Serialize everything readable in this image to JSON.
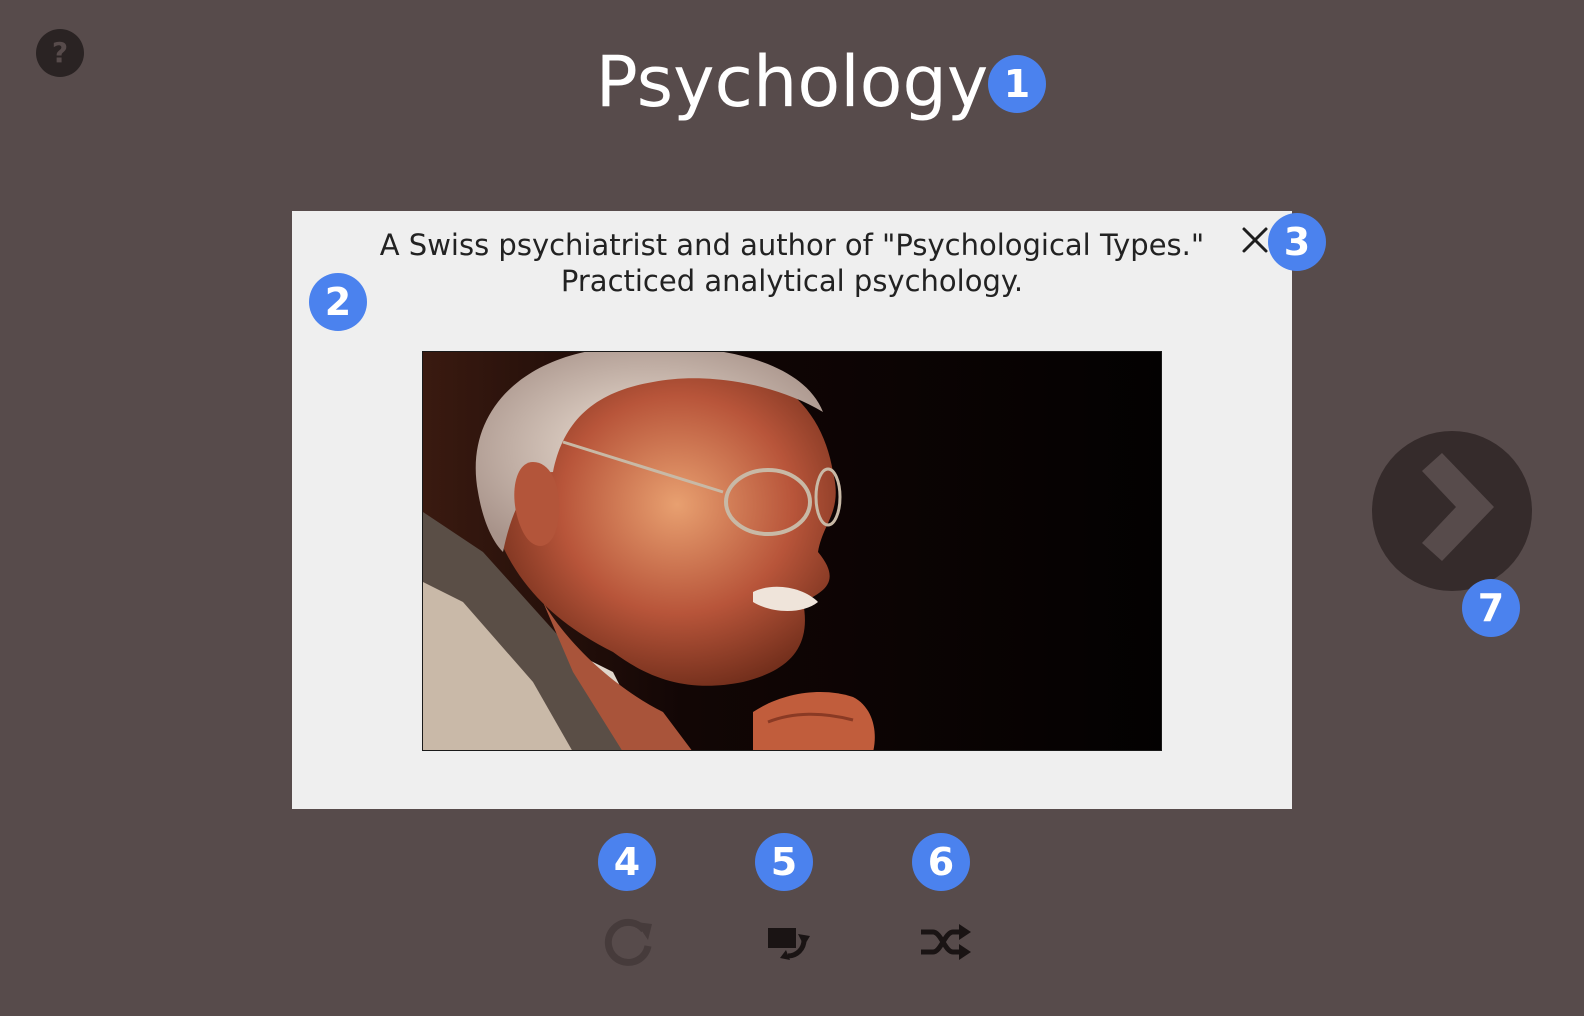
{
  "header": {
    "title": "Psychology",
    "help_label": "?"
  },
  "card": {
    "line1": "A Swiss psychiatrist and author of \"Psychological Types.\"",
    "line2": "Practiced analytical psychology.",
    "image_icon": "portrait-photo"
  },
  "controls": {
    "restart_icon": "restart-icon",
    "flip_icon": "flip-card-icon",
    "shuffle_icon": "shuffle-icon",
    "next_icon": "chevron-right-icon",
    "close_icon": "close-icon"
  },
  "badges": [
    "1",
    "2",
    "3",
    "4",
    "5",
    "6",
    "7"
  ],
  "colors": {
    "background": "#574b4b",
    "card": "#efefef",
    "badge": "#4b82ee",
    "next_button": "#352b2b",
    "help_button": "#2a2323"
  }
}
